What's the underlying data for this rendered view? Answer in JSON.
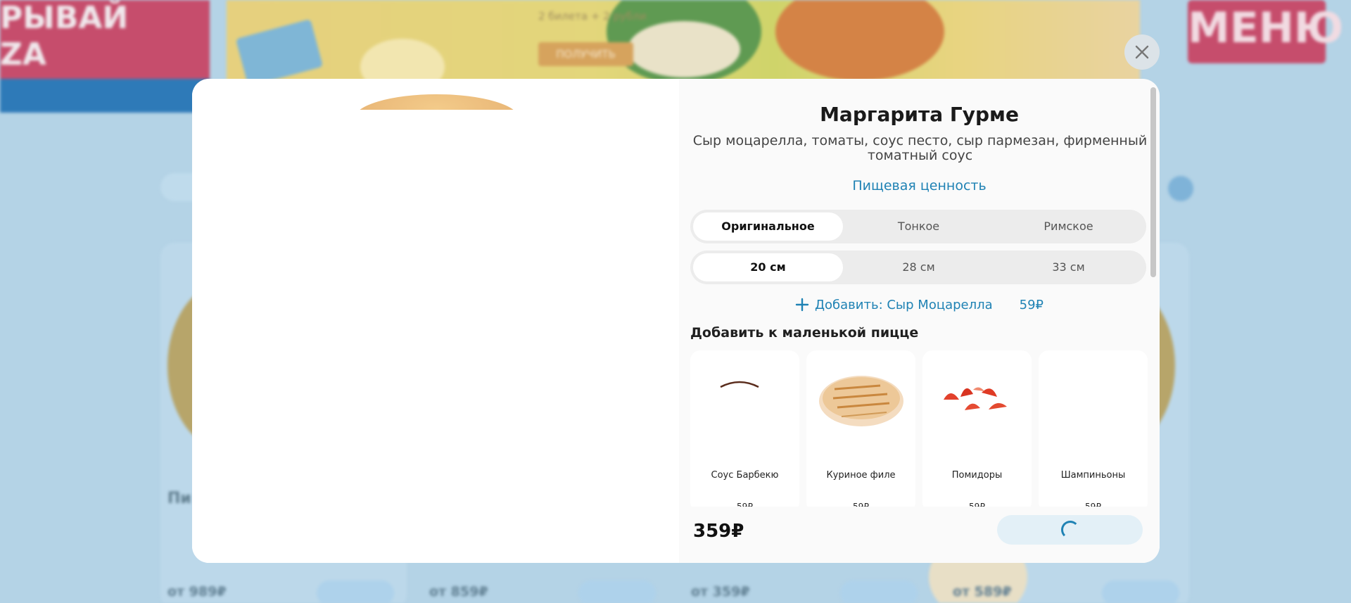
{
  "background": {
    "banner_left_text": "РЫВАЙ\nZA",
    "banner_note": "2 билета + 2 рубли",
    "banner_button": "ПОЛУЧИТЬ",
    "banner_right_text": "МЕНЮ",
    "card_title": "Пи",
    "prices": [
      "от 989₽",
      "от 859₽",
      "от 359₽",
      "от 589₽"
    ]
  },
  "modal": {
    "close_icon": "close-icon",
    "title": "Маргарита Гурме",
    "description": "Сыр моцарелла, томаты, соус песто, сыр пармезан, фирменный томатный соус",
    "nutrition_link": "Пищевая ценность",
    "dough_options": [
      {
        "label": "Оригинальное",
        "active": true
      },
      {
        "label": "Тонкое",
        "active": false
      },
      {
        "label": "Римское",
        "active": false
      }
    ],
    "size_options": [
      {
        "label": "20 см",
        "active": true
      },
      {
        "label": "28 см",
        "active": false
      },
      {
        "label": "33 см",
        "active": false
      }
    ],
    "add_cheese": {
      "icon": "plus-icon",
      "label": "Добавить: Сыр Моцарелла",
      "price": "59₽"
    },
    "toppings_title": "Добавить к маленькой пицце",
    "toppings": [
      {
        "name": "Соус Барбекю",
        "price": "59₽",
        "image": "bbq-sauce-image"
      },
      {
        "name": "Куриное филе",
        "price": "59₽",
        "image": "chicken-fillet-image"
      },
      {
        "name": "Помидоры",
        "price": "59₽",
        "image": "tomatoes-image"
      },
      {
        "name": "Шампиньоны",
        "price": "59₽",
        "image": "mushrooms-image"
      }
    ],
    "total_price": "359₽",
    "add_to_cart_state": "loading"
  },
  "colors": {
    "accent": "#1f82b4",
    "overlay_bg": "#b4d3e6",
    "modal_bg": "#fafafa"
  }
}
